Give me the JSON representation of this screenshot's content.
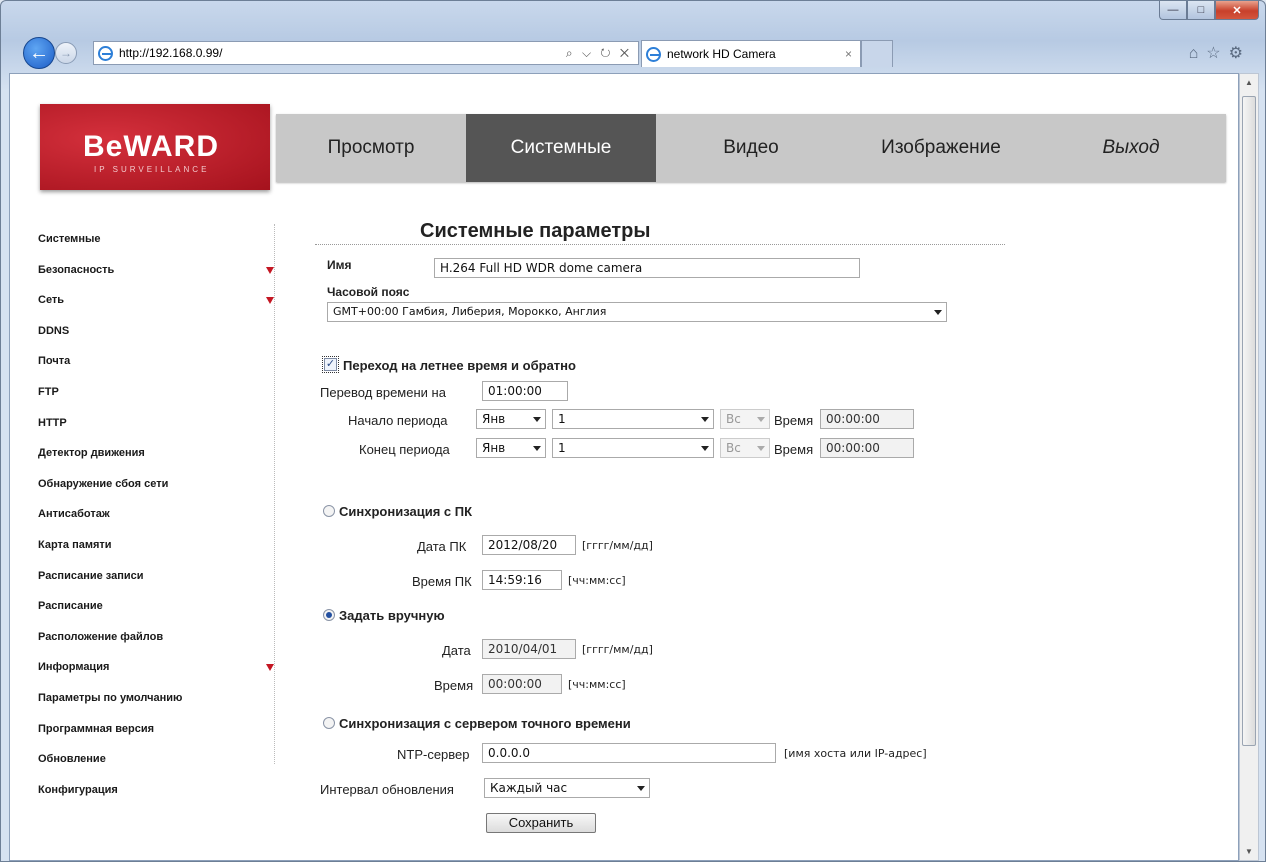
{
  "browser": {
    "url": "http://192.168.0.99/",
    "address_tools": "⌕ ⌵ ↻ ✕",
    "tab_title": "network HD Camera",
    "tab_close": "×",
    "right_icons": "⌂☆⚙"
  },
  "logo": {
    "brand": "BeWARD",
    "sub": "IP SURVEILLANCE"
  },
  "nav": {
    "items": [
      "Просмотр",
      "Системные",
      "Видео",
      "Изображение",
      "Выход"
    ]
  },
  "sidebar": {
    "items": [
      "Системные",
      "Безопасность",
      "Сеть",
      "DDNS",
      "Почта",
      "FTP",
      "HTTP",
      "Детектор движения",
      "Обнаружение сбоя сети",
      "Антисаботаж",
      "Карта памяти",
      "Расписание записи",
      "Расписание",
      "Расположение файлов",
      "Информация",
      "Параметры по умолчанию",
      "Программная версия",
      "Обновление",
      "Конфигурация"
    ]
  },
  "page": {
    "title": "Системные параметры",
    "name_label": "Имя",
    "name_value": "H.264 Full HD WDR dome camera",
    "tz_label": "Часовой пояс",
    "tz_value": "GMT+00:00 Гамбия, Либерия, Морокко, Англия",
    "dst": {
      "label": "Переход на летнее время и обратно",
      "checked": true,
      "shift_label": "Перевод времени на",
      "shift_value": "01:00:00",
      "start_label": "Начало периода",
      "end_label": "Конец периода",
      "month": "Янв",
      "week": "1",
      "day": "Вс",
      "time_label": "Время",
      "time_value": "00:00:00"
    },
    "sync_pc": {
      "label": "Синхронизация с ПК",
      "date_label": "Дата ПК",
      "date_value": "2012/08/20",
      "date_hint": "[гггг/мм/дд]",
      "time_label": "Время ПК",
      "time_value": "14:59:16",
      "time_hint": "[чч:мм:сс]"
    },
    "manual": {
      "label": "Задать вручную",
      "date_label": "Дата",
      "date_value": "2010/04/01",
      "date_hint": "[гггг/мм/дд]",
      "time_label": "Время",
      "time_value": "00:00:00",
      "time_hint": "[чч:мм:сс]"
    },
    "ntp": {
      "label": "Синхронизация с сервером точного времени",
      "server_label": "NTP-сервер",
      "server_value": "0.0.0.0",
      "server_hint": "[имя хоста или IP-адрес]",
      "interval_label": "Интервал обновления",
      "interval_value": "Каждый час"
    },
    "save_label": "Сохранить"
  }
}
